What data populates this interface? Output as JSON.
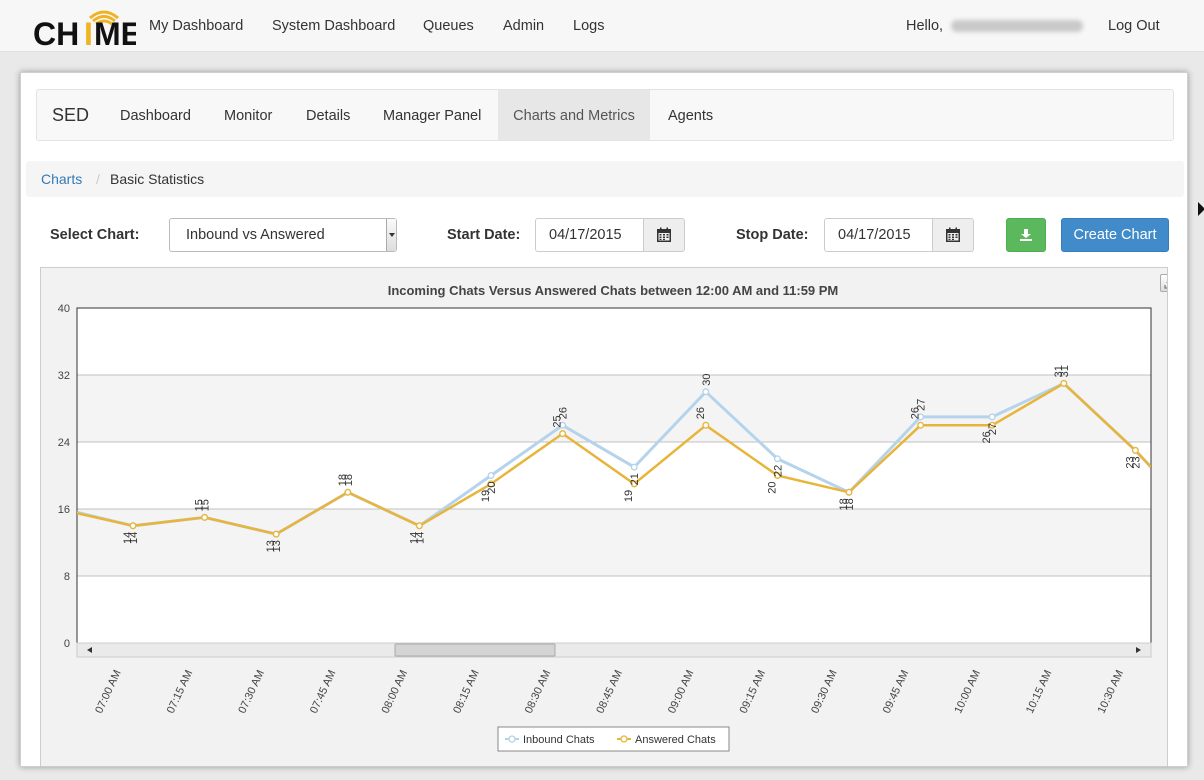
{
  "topbar": {
    "logo_text": "CHIME",
    "nav": [
      "My Dashboard",
      "System Dashboard",
      "Queues",
      "Admin",
      "Logs"
    ],
    "hello_label": "Hello,",
    "logout_label": "Log Out",
    "brand_color": "#f0b323"
  },
  "subnav": {
    "brand": "SED",
    "tabs": [
      "Dashboard",
      "Monitor",
      "Details",
      "Manager Panel",
      "Charts and Metrics",
      "Agents"
    ],
    "active_tab": "Charts and Metrics"
  },
  "breadcrumb": {
    "link": "Charts",
    "separator": "/",
    "current": "Basic Statistics"
  },
  "controls": {
    "select_label": "Select Chart:",
    "select_value": "Inbound vs Answered",
    "start_label": "Start Date:",
    "start_value": "04/17/2015",
    "stop_label": "Stop Date:",
    "stop_value": "04/17/2015",
    "create_label": "Create Chart",
    "download_icon": "download-icon",
    "calendar_icon": "calendar-icon"
  },
  "chart_data": {
    "type": "line",
    "title": "Incoming Chats Versus Answered Chats between 12:00 AM and 11:59 PM",
    "ylim": [
      0,
      40
    ],
    "yticks": [
      0,
      8,
      16,
      24,
      32,
      40
    ],
    "grid": true,
    "legend": "bottom-center",
    "x_tick_labels": [
      "07:00 AM",
      "07:15 AM",
      "07:30 AM",
      "07:45 AM",
      "08:00 AM",
      "08:15 AM",
      "08:30 AM",
      "08:45 AM",
      "09:00 AM",
      "09:15 AM",
      "09:30 AM",
      "09:45 AM",
      "10:00 AM",
      "10:15 AM",
      "10:30 AM"
    ],
    "series": [
      {
        "name": "Inbound Chats",
        "color": "#b5d3ea",
        "values": [
          14,
          15,
          13,
          18,
          14,
          20,
          26,
          21,
          30,
          22,
          18,
          27,
          27,
          31,
          23
        ],
        "labels": [
          "14",
          "15",
          "13",
          "18",
          "14",
          "20",
          "26",
          "21",
          "30",
          "22",
          "18",
          "27",
          "27",
          "31",
          "23"
        ]
      },
      {
        "name": "Answered Chats",
        "color": "#e8b53a",
        "values": [
          14,
          15,
          13,
          18,
          14,
          19,
          25,
          19,
          26,
          20,
          18,
          26,
          26,
          31,
          23
        ],
        "labels": [
          "14",
          "15",
          "13",
          "18",
          "14",
          "19",
          "25",
          "19",
          "26",
          "20",
          "18",
          "26",
          "26",
          "31",
          "23"
        ]
      }
    ],
    "edge_values": {
      "left": 15.5,
      "right": 21
    }
  }
}
